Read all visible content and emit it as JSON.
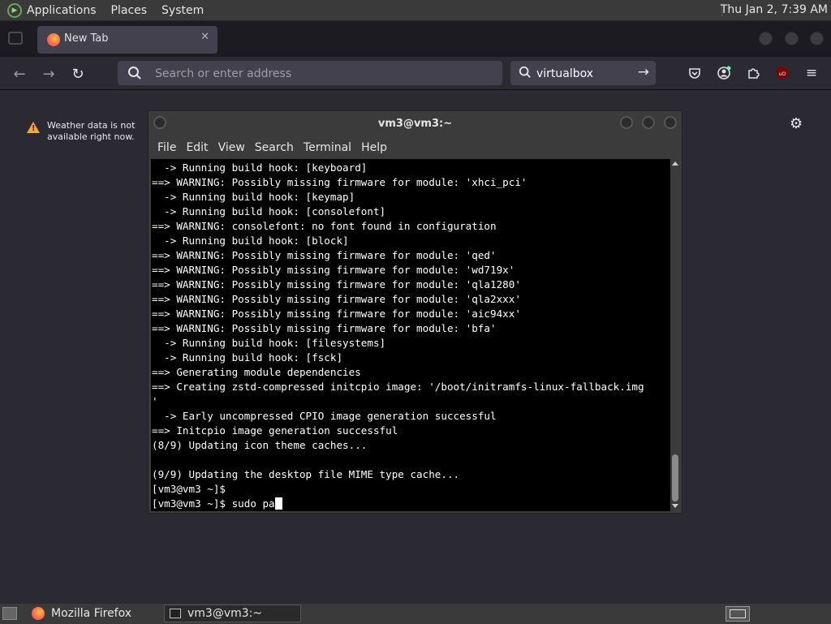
{
  "top_panel": {
    "menus": [
      "Applications",
      "Places",
      "System"
    ],
    "clock": "Thu Jan  2,  7:39 AM"
  },
  "browser": {
    "tab": {
      "title": "New Tab"
    },
    "urlbar": {
      "placeholder": "Search or enter address"
    },
    "searchbar": {
      "value": "virtualbox"
    },
    "weather": {
      "line1": "Weather data is not",
      "line2": "available right now."
    }
  },
  "terminal": {
    "title": "vm3@vm3:~",
    "menus": [
      "File",
      "Edit",
      "View",
      "Search",
      "Terminal",
      "Help"
    ],
    "lines": [
      "  -> Running build hook: [keyboard]",
      "==> WARNING: Possibly missing firmware for module: 'xhci_pci'",
      "  -> Running build hook: [keymap]",
      "  -> Running build hook: [consolefont]",
      "==> WARNING: consolefont: no font found in configuration",
      "  -> Running build hook: [block]",
      "==> WARNING: Possibly missing firmware for module: 'qed'",
      "==> WARNING: Possibly missing firmware for module: 'wd719x'",
      "==> WARNING: Possibly missing firmware for module: 'qla1280'",
      "==> WARNING: Possibly missing firmware for module: 'qla2xxx'",
      "==> WARNING: Possibly missing firmware for module: 'aic94xx'",
      "==> WARNING: Possibly missing firmware for module: 'bfa'",
      "  -> Running build hook: [filesystems]",
      "  -> Running build hook: [fsck]",
      "==> Generating module dependencies",
      "==> Creating zstd-compressed initcpio image: '/boot/initramfs-linux-fallback.img",
      "'",
      "  -> Early uncompressed CPIO image generation successful",
      "==> Initcpio image generation successful",
      "(8/9) Updating icon theme caches...",
      "",
      "(9/9) Updating the desktop file MIME type cache...",
      "[vm3@vm3 ~]$",
      "[vm3@vm3 ~]$ sudo pa"
    ]
  },
  "taskbar": {
    "items": [
      {
        "label": "Mozilla Firefox"
      },
      {
        "label": "vm3@vm3:~"
      }
    ]
  }
}
